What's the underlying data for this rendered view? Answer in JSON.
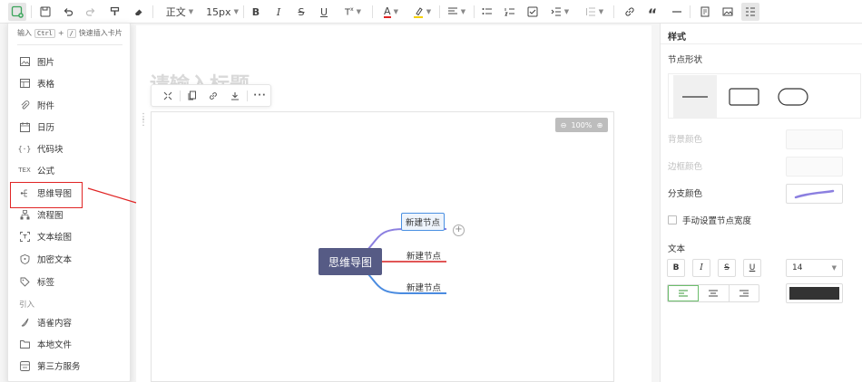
{
  "toolbar": {
    "paragraph_label": "正文",
    "fontsize_label": "15px",
    "bold_label": "B",
    "italic_label": "I",
    "underline_label": "U",
    "strike_label": "S",
    "font_color_label": "A",
    "quote_label": "“"
  },
  "document": {
    "title_placeholder": "请输入标题"
  },
  "mini_toolbar": {
    "more_label": "···"
  },
  "mindmap": {
    "zoom_label": "100%",
    "root_label": "思维导图",
    "children": [
      {
        "label": "新建节点",
        "color": "#8b7fe0"
      },
      {
        "label": "新建节点",
        "color": "#e15656"
      },
      {
        "label": "新建节点",
        "color": "#4a8be0"
      }
    ],
    "add_symbol": "+"
  },
  "insert_menu": {
    "hint_prefix": "输入",
    "hint_key1": "Ctrl",
    "hint_plus": "+",
    "hint_key2": "/",
    "hint_suffix": "快速插入卡片",
    "items": [
      {
        "label": "图片",
        "icon": "image-icon"
      },
      {
        "label": "表格",
        "icon": "table-icon"
      },
      {
        "label": "附件",
        "icon": "attachment-icon"
      },
      {
        "label": "日历",
        "icon": "calendar-icon"
      },
      {
        "label": "代码块",
        "icon": "code-block-icon"
      },
      {
        "label": "公式",
        "icon": "formula-icon"
      },
      {
        "label": "思维导图",
        "icon": "mindmap-icon"
      },
      {
        "label": "流程图",
        "icon": "flowchart-icon"
      },
      {
        "label": "文本绘图",
        "icon": "text-drawing-icon"
      },
      {
        "label": "加密文本",
        "icon": "encrypt-icon"
      },
      {
        "label": "标签",
        "icon": "tag-icon"
      }
    ],
    "section_label": "引入",
    "import_items": [
      {
        "label": "语雀内容",
        "icon": "yuque-icon"
      },
      {
        "label": "本地文件",
        "icon": "folder-icon"
      },
      {
        "label": "第三方服务",
        "icon": "service-icon"
      }
    ],
    "highlight_color": "#e02424"
  },
  "style_panel": {
    "title": "样式",
    "node_shape_label": "节点形状",
    "bg_color_label": "背景颜色",
    "border_color_label": "边框颜色",
    "branch_color_label": "分支颜色",
    "branch_color": "#8b7fe0",
    "manual_width_label": "手动设置节点宽度",
    "text_label": "文本",
    "bold_label": "B",
    "italic_label": "I",
    "strike_label": "S",
    "underline_label": "U",
    "font_size_value": "14",
    "text_color": "#333333"
  }
}
